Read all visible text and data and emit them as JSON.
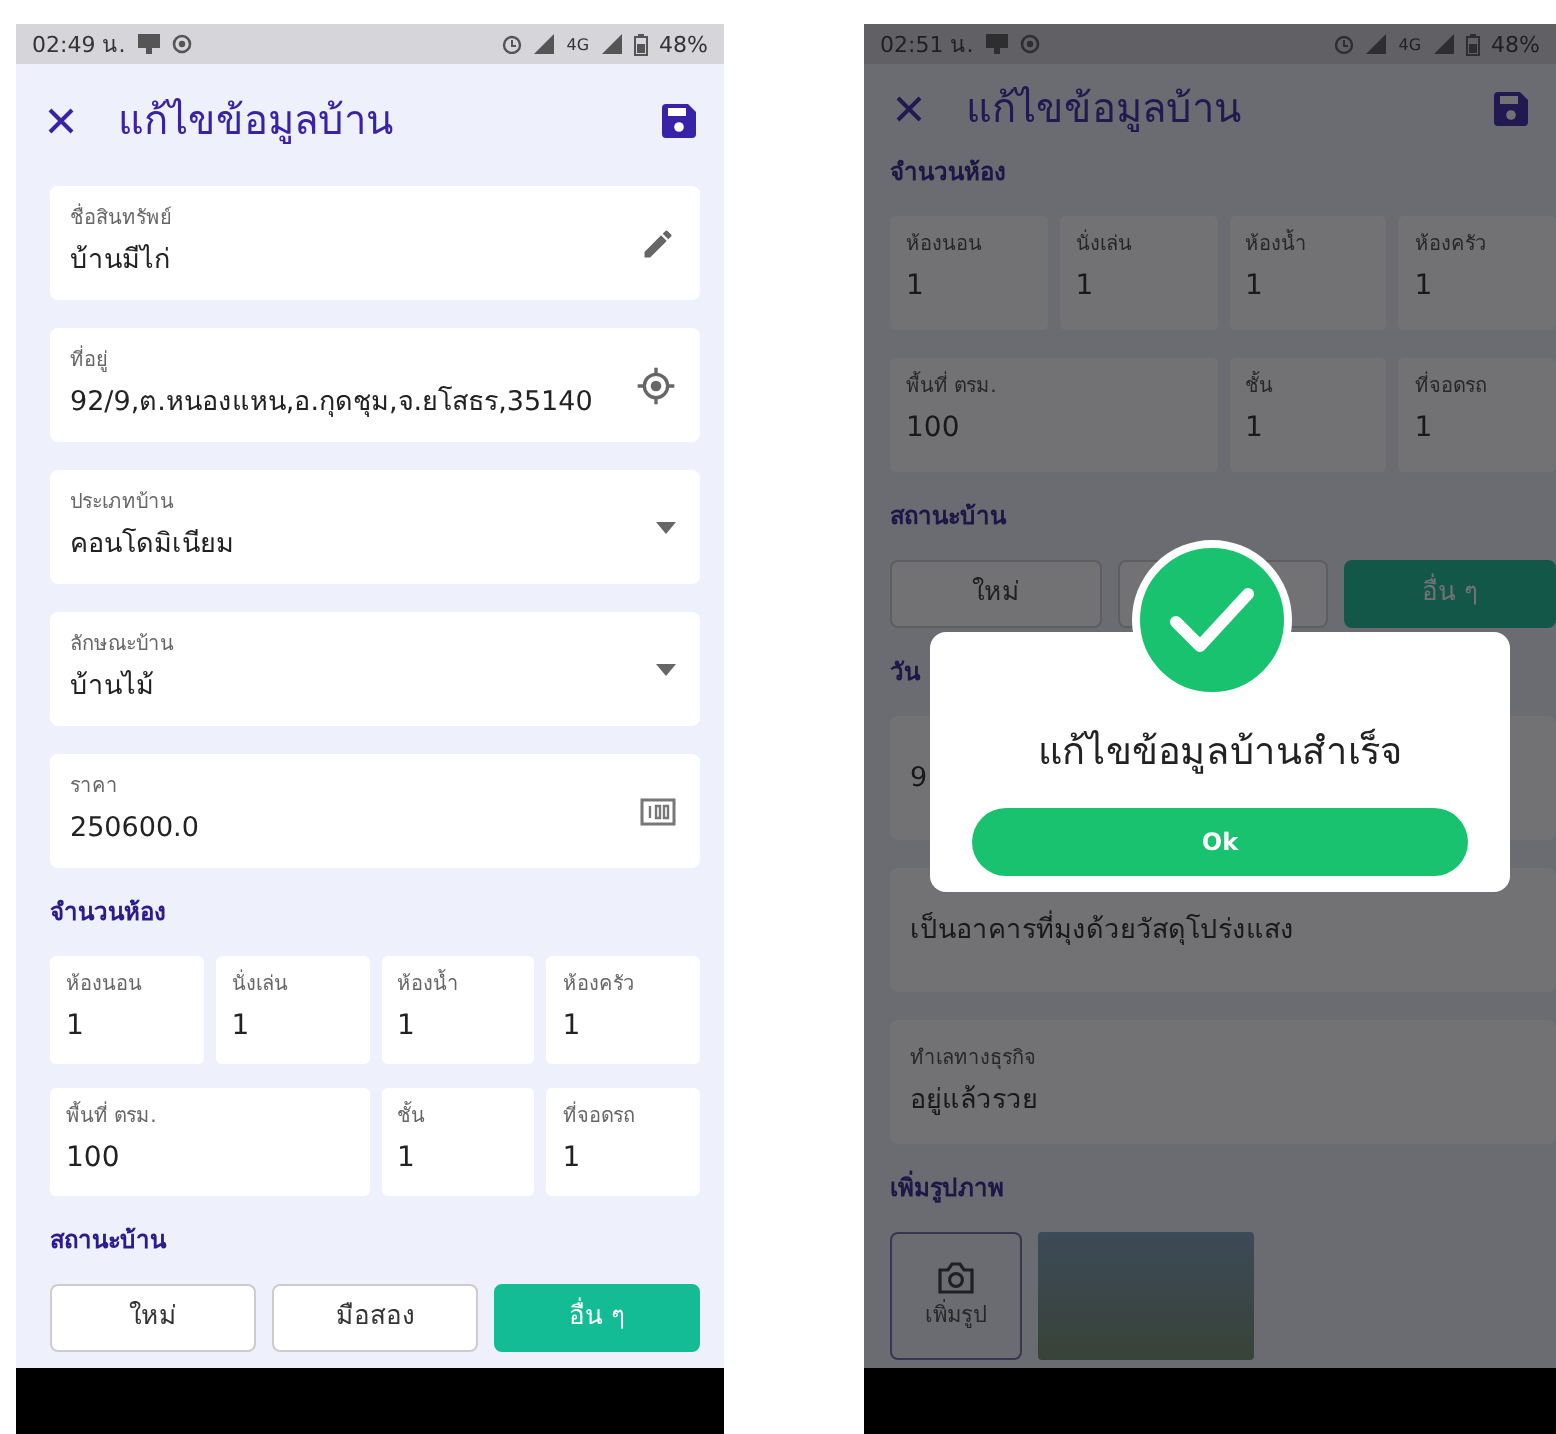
{
  "screens": [
    {
      "status_bar": {
        "time": "02:49 น.",
        "network": "4G",
        "battery": "48%"
      },
      "toolbar": {
        "title": "แก้ไขข้อมูลบ้าน"
      },
      "sections": [
        {
          "kind": "edit_field",
          "label": "ชื่อสินทรัพย์",
          "value": "บ้านมีไก่"
        },
        {
          "kind": "location_field",
          "label": "ที่อยู่",
          "value": "92/9,ต.หนองแหน,อ.กุดชุม,จ.ยโสธร,35140"
        },
        {
          "kind": "select_field",
          "label": "ประเภทบ้าน",
          "value": "คอนโดมิเนียม"
        },
        {
          "kind": "select_field",
          "label": "ลักษณะบ้าน",
          "value": "บ้านไม้"
        },
        {
          "kind": "price_field",
          "label": "ราคา",
          "value": "250600.0"
        },
        {
          "kind": "heading",
          "text": "จำนวนห้อง"
        },
        {
          "kind": "grid",
          "cells": [
            {
              "label": "ห้องนอน",
              "value": "1",
              "wide": false
            },
            {
              "label": "นั่งเล่น",
              "value": "1",
              "wide": false
            },
            {
              "label": "ห้องน้ำ",
              "value": "1",
              "wide": false
            },
            {
              "label": "ห้องครัว",
              "value": "1",
              "wide": false
            },
            {
              "label": "พื้นที่ ตรม.",
              "value": "100",
              "wide": true
            },
            {
              "label": "ชั้น",
              "value": "1",
              "wide": false
            },
            {
              "label": "ที่จอดรถ",
              "value": "1",
              "wide": false
            }
          ]
        },
        {
          "kind": "heading",
          "text": "สถานะบ้าน"
        },
        {
          "kind": "choice",
          "options": [
            {
              "label": "ใหม่",
              "selected": false
            },
            {
              "label": "มือสอง",
              "selected": false
            },
            {
              "label": "อื่น ๆ",
              "selected": true
            }
          ]
        }
      ]
    },
    {
      "status_bar": {
        "time": "02:51 น.",
        "network": "4G",
        "battery": "48%"
      },
      "toolbar": {
        "title": "แก้ไขข้อมูลบ้าน"
      },
      "sections": [
        {
          "kind": "heading",
          "text": "จำนวนห้อง"
        },
        {
          "kind": "grid",
          "cells": [
            {
              "label": "ห้องนอน",
              "value": "1",
              "wide": false
            },
            {
              "label": "นั่งเล่น",
              "value": "1",
              "wide": false
            },
            {
              "label": "ห้องน้ำ",
              "value": "1",
              "wide": false
            },
            {
              "label": "ห้องครัว",
              "value": "1",
              "wide": false
            },
            {
              "label": "พื้นที่ ตรม.",
              "value": "100",
              "wide": true
            },
            {
              "label": "ชั้น",
              "value": "1",
              "wide": false
            },
            {
              "label": "ที่จอดรถ",
              "value": "1",
              "wide": false
            }
          ]
        },
        {
          "kind": "heading",
          "text": "สถานะบ้าน"
        },
        {
          "kind": "choice",
          "options": [
            {
              "label": "ใหม่",
              "selected": false
            },
            {
              "selected": false
            },
            {
              "label": "อื่น ๆ",
              "selected": true
            }
          ]
        },
        {
          "kind": "heading",
          "text": "วัน"
        },
        {
          "kind": "field",
          "value": "9"
        },
        {
          "kind": "field",
          "value": "เป็นอาคารที่มุงด้วยวัสดุโปร่งแสง"
        },
        {
          "kind": "field",
          "label": "ทำเลทางธุรกิจ",
          "value": "อยู่แล้วรวย"
        },
        {
          "kind": "heading",
          "text": "เพิ่มรูปภาพ"
        },
        {
          "kind": "photos",
          "add_label": "เพิ่มรูป"
        }
      ],
      "dialog": {
        "message": "แก้ไขข้อมูลบ้านสำเร็จ",
        "button": "Ok"
      }
    }
  ]
}
